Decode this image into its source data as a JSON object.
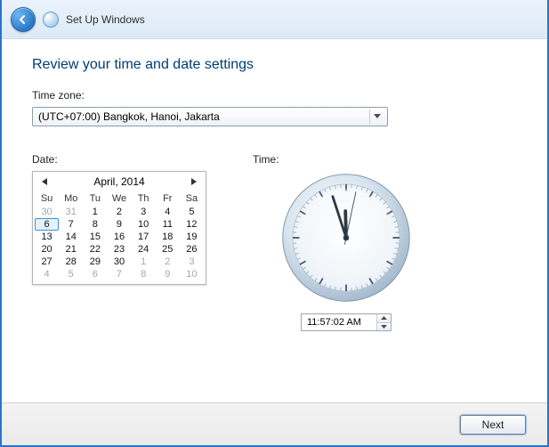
{
  "titlebar": {
    "title": "Set Up Windows"
  },
  "heading": "Review your time and date settings",
  "timezone": {
    "label": "Time zone:",
    "selected": "(UTC+07:00) Bangkok, Hanoi, Jakarta"
  },
  "date": {
    "label": "Date:",
    "month_label": "April, 2014",
    "dow": [
      "Su",
      "Mo",
      "Tu",
      "We",
      "Th",
      "Fr",
      "Sa"
    ],
    "days": [
      {
        "n": "30",
        "out": true
      },
      {
        "n": "31",
        "out": true
      },
      {
        "n": "1"
      },
      {
        "n": "2"
      },
      {
        "n": "3"
      },
      {
        "n": "4"
      },
      {
        "n": "5"
      },
      {
        "n": "6",
        "sel": true
      },
      {
        "n": "7"
      },
      {
        "n": "8"
      },
      {
        "n": "9"
      },
      {
        "n": "10"
      },
      {
        "n": "11"
      },
      {
        "n": "12"
      },
      {
        "n": "13"
      },
      {
        "n": "14"
      },
      {
        "n": "15"
      },
      {
        "n": "16"
      },
      {
        "n": "17"
      },
      {
        "n": "18"
      },
      {
        "n": "19"
      },
      {
        "n": "20"
      },
      {
        "n": "21"
      },
      {
        "n": "22"
      },
      {
        "n": "23"
      },
      {
        "n": "24"
      },
      {
        "n": "25"
      },
      {
        "n": "26"
      },
      {
        "n": "27"
      },
      {
        "n": "28"
      },
      {
        "n": "29"
      },
      {
        "n": "30"
      },
      {
        "n": "1",
        "out": true
      },
      {
        "n": "2",
        "out": true
      },
      {
        "n": "3",
        "out": true
      },
      {
        "n": "4",
        "out": true
      },
      {
        "n": "5",
        "out": true
      },
      {
        "n": "6",
        "out": true
      },
      {
        "n": "7",
        "out": true
      },
      {
        "n": "8",
        "out": true
      },
      {
        "n": "9",
        "out": true
      },
      {
        "n": "10",
        "out": true
      }
    ]
  },
  "time": {
    "label": "Time:",
    "value": "11:57:02 AM",
    "hour": 11,
    "minute": 57,
    "second": 2
  },
  "next_label": "Next"
}
